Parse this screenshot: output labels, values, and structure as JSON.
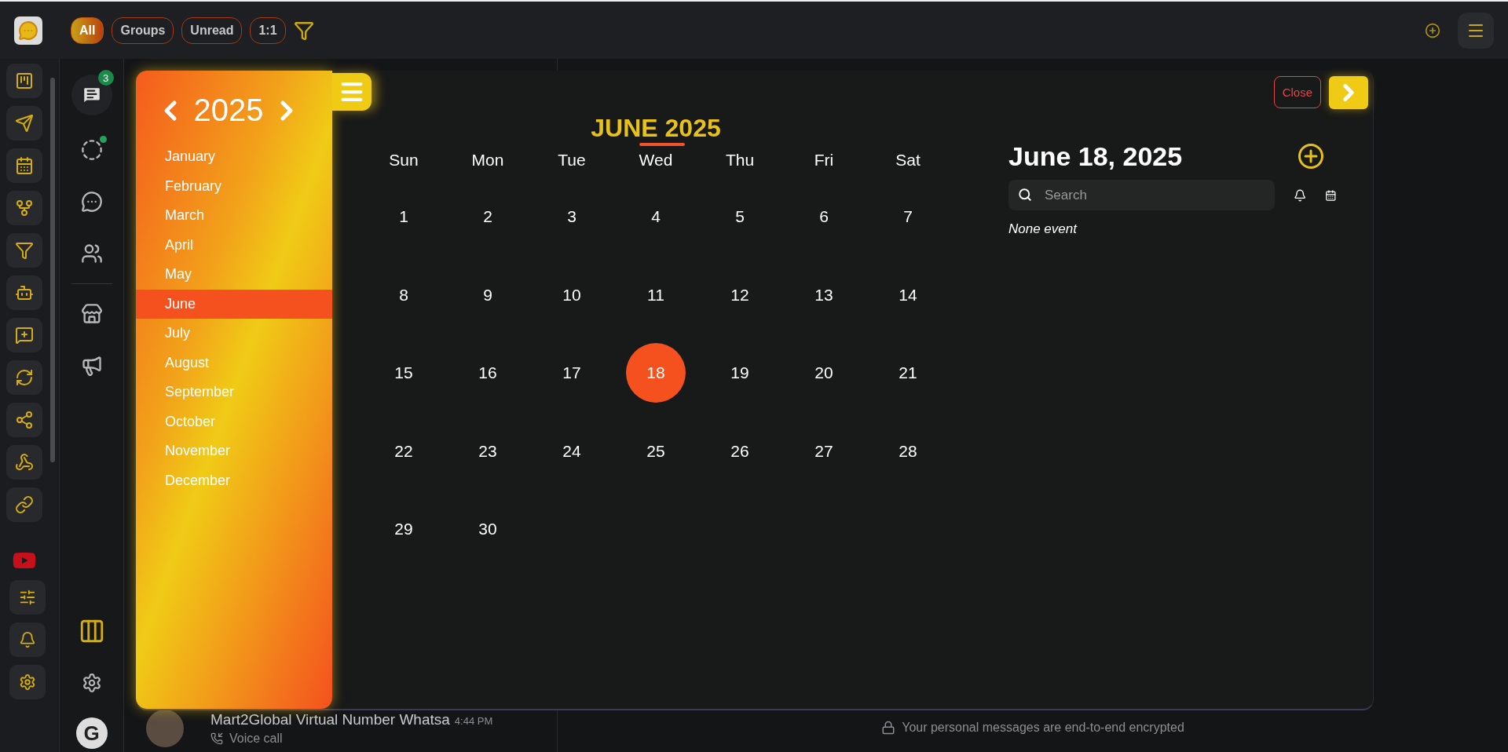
{
  "top_bar": {
    "filters": [
      {
        "label": "All",
        "selected": true
      },
      {
        "label": "Groups",
        "selected": false
      },
      {
        "label": "Unread",
        "selected": false
      },
      {
        "label": "1:1",
        "selected": false
      }
    ]
  },
  "nav_rail": {
    "badge": "3",
    "status_dot": true,
    "avatar_initial": "G"
  },
  "chat_preview": {
    "name": "Mart2Global Virtual Number Whatsa",
    "time": "4:44 PM",
    "subtitle": "Voice call"
  },
  "encryption_notice": "Your personal messages are end-to-end encrypted",
  "calendar": {
    "year": "2025",
    "months": [
      {
        "label": "January",
        "selected": false
      },
      {
        "label": "February",
        "selected": false
      },
      {
        "label": "March",
        "selected": false
      },
      {
        "label": "April",
        "selected": false
      },
      {
        "label": "May",
        "selected": false
      },
      {
        "label": "June",
        "selected": true
      },
      {
        "label": "July",
        "selected": false
      },
      {
        "label": "August",
        "selected": false
      },
      {
        "label": "September",
        "selected": false
      },
      {
        "label": "October",
        "selected": false
      },
      {
        "label": "November",
        "selected": false
      },
      {
        "label": "December",
        "selected": false
      }
    ],
    "month_title": "JUNE 2025",
    "weekdays": [
      "Sun",
      "Mon",
      "Tue",
      "Wed",
      "Thu",
      "Fri",
      "Sat"
    ],
    "weeks": [
      [
        {
          "day": "1",
          "selected": false
        },
        {
          "day": "2",
          "selected": false
        },
        {
          "day": "3",
          "selected": false
        },
        {
          "day": "4",
          "selected": false
        },
        {
          "day": "5",
          "selected": false
        },
        {
          "day": "6",
          "selected": false
        },
        {
          "day": "7",
          "selected": false
        }
      ],
      [
        {
          "day": "8",
          "selected": false
        },
        {
          "day": "9",
          "selected": false
        },
        {
          "day": "10",
          "selected": false
        },
        {
          "day": "11",
          "selected": false
        },
        {
          "day": "12",
          "selected": false
        },
        {
          "day": "13",
          "selected": false
        },
        {
          "day": "14",
          "selected": false
        }
      ],
      [
        {
          "day": "15",
          "selected": false
        },
        {
          "day": "16",
          "selected": false
        },
        {
          "day": "17",
          "selected": false
        },
        {
          "day": "18",
          "selected": true
        },
        {
          "day": "19",
          "selected": false
        },
        {
          "day": "20",
          "selected": false
        },
        {
          "day": "21",
          "selected": false
        }
      ],
      [
        {
          "day": "22",
          "selected": false
        },
        {
          "day": "23",
          "selected": false
        },
        {
          "day": "24",
          "selected": false
        },
        {
          "day": "25",
          "selected": false
        },
        {
          "day": "26",
          "selected": false
        },
        {
          "day": "27",
          "selected": false
        },
        {
          "day": "28",
          "selected": false
        }
      ],
      [
        {
          "day": "29",
          "selected": false
        },
        {
          "day": "30",
          "selected": false
        }
      ]
    ],
    "close_button": "Close",
    "events_panel": {
      "date_title": "June 18, 2025",
      "search": {
        "placeholder": "Search"
      },
      "empty_text": "None event"
    }
  }
}
